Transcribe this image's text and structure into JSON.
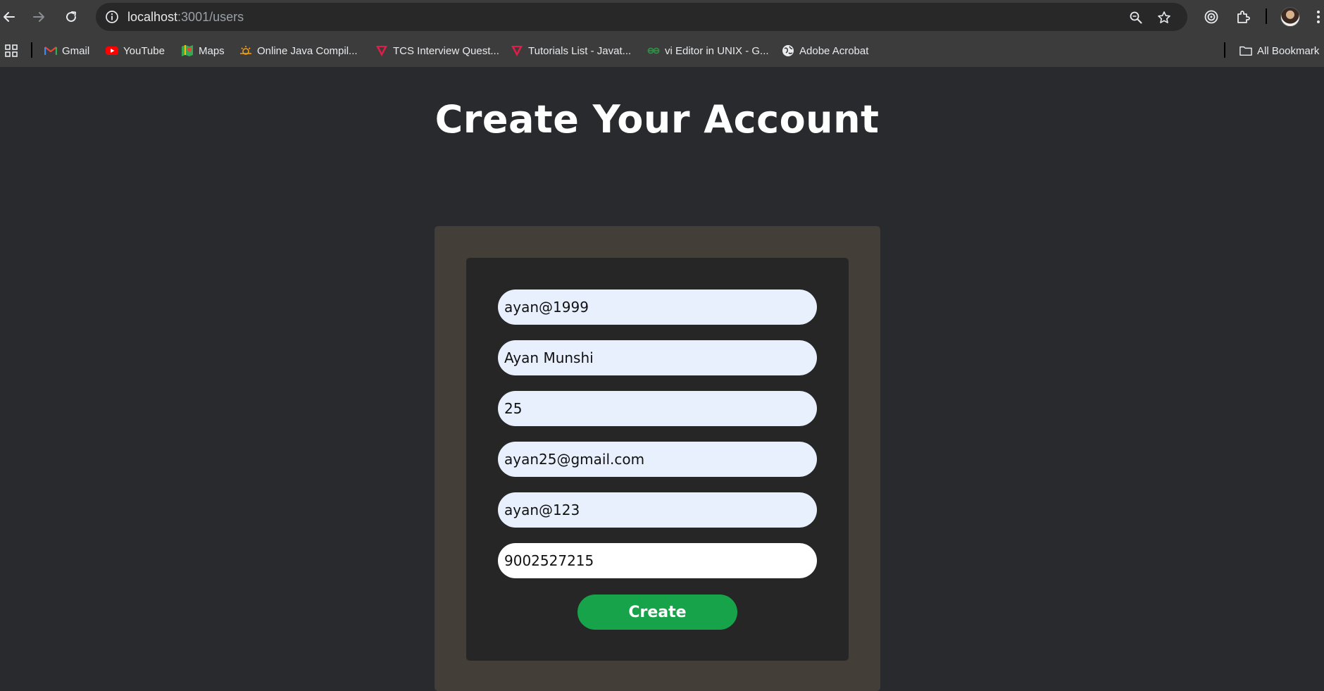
{
  "browser": {
    "url_host": "localhost",
    "url_path": ":3001/users",
    "back_icon": "arrow-left-icon",
    "forward_icon": "arrow-right-icon",
    "reload_icon": "reload-icon",
    "site_info_icon": "info-icon",
    "zoom_icon": "magnifier-icon",
    "bookmark_star_icon": "star-icon",
    "extensions_icon": "puzzle-icon",
    "menu_icon": "kebab-menu-icon"
  },
  "bookmarks": {
    "items": [
      {
        "label": "Gmail",
        "icon": "gmail-icon",
        "color": "#ea4335"
      },
      {
        "label": "YouTube",
        "icon": "youtube-icon",
        "color": "#ff0000"
      },
      {
        "label": "Maps",
        "icon": "maps-icon",
        "color": "#34a853"
      },
      {
        "label": "Online Java Compil...",
        "icon": "compiler-icon",
        "color": "#f59e0b"
      },
      {
        "label": "TCS Interview Quest...",
        "icon": "tcs-icon",
        "color": "#e11d48"
      },
      {
        "label": "Tutorials List - Javat...",
        "icon": "javatpoint-icon",
        "color": "#e11d48"
      },
      {
        "label": "vi Editor in UNIX - G...",
        "icon": "geeksforgeeks-icon",
        "color": "#2f8d46"
      },
      {
        "label": "Adobe Acrobat",
        "icon": "globe-icon",
        "color": "#e8eaed"
      }
    ],
    "all_bookmarks_label": "All Bookmark"
  },
  "page": {
    "title": "Create Your Account"
  },
  "form": {
    "fields": [
      {
        "value": "ayan@1999"
      },
      {
        "value": "Ayan Munshi"
      },
      {
        "value": "25"
      },
      {
        "value": "ayan25@gmail.com"
      },
      {
        "value": "ayan@123"
      },
      {
        "value": "9002527215"
      }
    ],
    "submit_label": "Create",
    "submit_color": "#16a34a"
  }
}
